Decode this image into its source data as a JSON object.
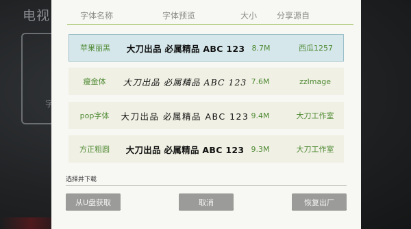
{
  "background": {
    "title": "电视",
    "partial_text": "字"
  },
  "dialog": {
    "columns": [
      "字体名称",
      "字体预览",
      "大小",
      "分享源自"
    ],
    "rows": [
      {
        "name": "苹果丽黑",
        "preview": "大刀出品 必属精品 ABC 123",
        "size": "8.7M",
        "source": "西瓜1257",
        "selected": true
      },
      {
        "name": "瘦金体",
        "preview": "大刀出品 必属精品 ABC 123",
        "size": "7.6M",
        "source": "zzImage",
        "selected": false
      },
      {
        "name": "pop字体",
        "preview": "大刀出品 必属精品 ABC 123",
        "size": "9.4M",
        "source": "大刀工作室",
        "selected": false
      },
      {
        "name": "方正粗圆",
        "preview": "大刀出品 必属精品 ABC 123",
        "size": "9.3M",
        "source": "大刀工作室",
        "selected": false
      }
    ],
    "hint": "选择并下载",
    "buttons": {
      "usb": "从U盘获取",
      "cancel": "取消",
      "restore": "恢复出厂"
    }
  },
  "colors": {
    "accent_line": "#9fc15c",
    "green_text": "#4f8a34",
    "selected_row": "#d6e7eb",
    "row_bg": "#f0f0e4",
    "button_bg": "#9b9b99"
  }
}
